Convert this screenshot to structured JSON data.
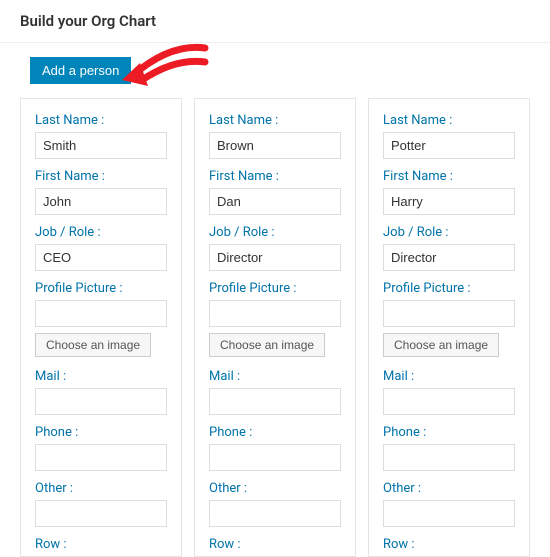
{
  "page": {
    "title": "Build your Org Chart"
  },
  "toolbar": {
    "add_label": "Add a person"
  },
  "labels": {
    "last_name": "Last Name :",
    "first_name": "First Name :",
    "job": "Job / Role :",
    "profile_picture": "Profile Picture :",
    "choose_image": "Choose an image",
    "mail": "Mail :",
    "phone": "Phone :",
    "other": "Other :",
    "row": "Row :"
  },
  "persons": [
    {
      "last_name": "Smith",
      "first_name": "John",
      "job": "CEO",
      "profile_picture": "",
      "mail": "",
      "phone": "",
      "other": "",
      "row": ""
    },
    {
      "last_name": "Brown",
      "first_name": "Dan",
      "job": "Director",
      "profile_picture": "",
      "mail": "",
      "phone": "",
      "other": "",
      "row": ""
    },
    {
      "last_name": "Potter",
      "first_name": "Harry",
      "job": "Director",
      "profile_picture": "",
      "mail": "",
      "phone": "",
      "other": "",
      "row": ""
    }
  ]
}
